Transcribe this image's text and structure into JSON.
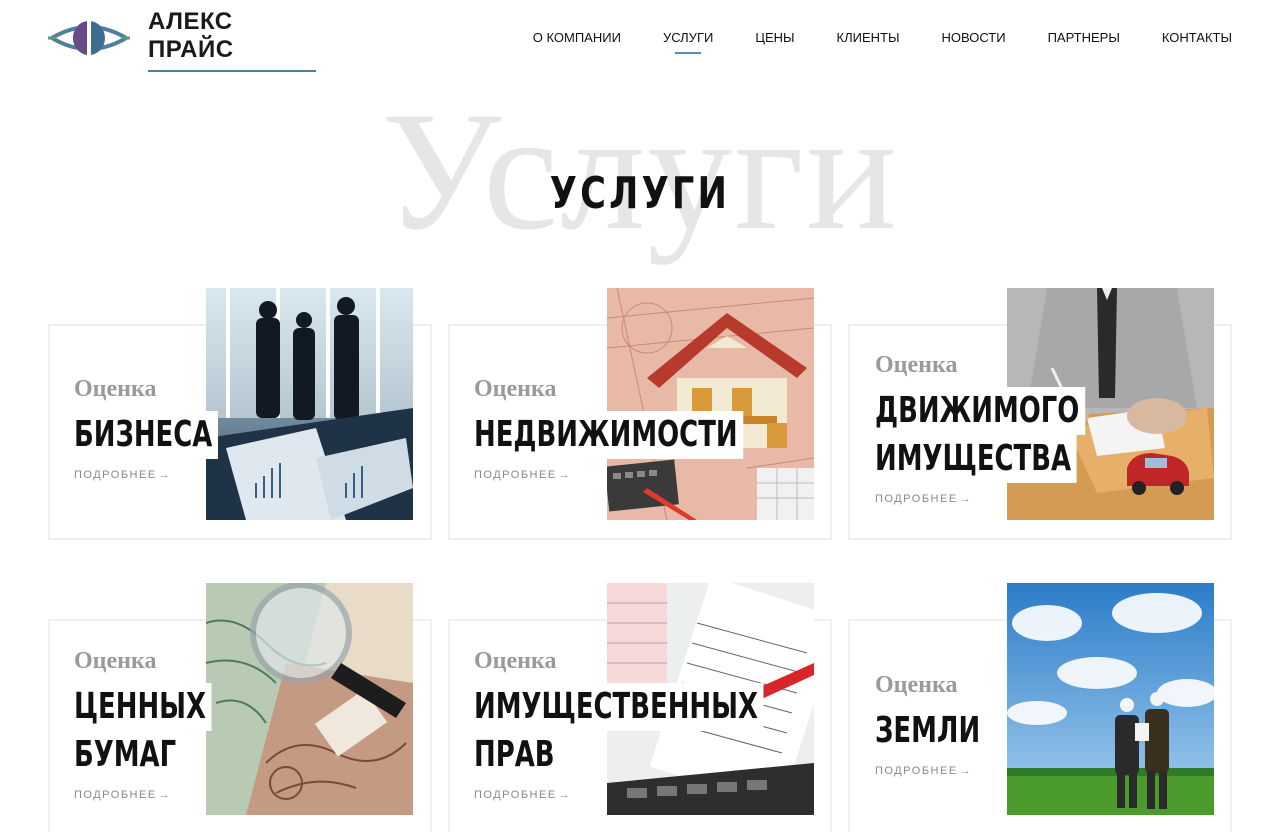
{
  "brand": {
    "name": "АЛЕКС ПРАЙС",
    "accent": "#4a7fa0"
  },
  "nav": [
    {
      "label": "О КОМПАНИИ",
      "active": false
    },
    {
      "label": "УСЛУГИ",
      "active": true
    },
    {
      "label": "ЦЕНЫ",
      "active": false
    },
    {
      "label": "КЛИЕНТЫ",
      "active": false
    },
    {
      "label": "НОВОСТИ",
      "active": false
    },
    {
      "label": "ПАРТНЕРЫ",
      "active": false
    },
    {
      "label": "КОНТАКТЫ",
      "active": false
    }
  ],
  "section": {
    "bg_word": "Услуги",
    "title": "УСЛУГИ"
  },
  "cards": [
    {
      "pre": "Оценка",
      "title_lines": [
        "БИЗНЕСА"
      ],
      "more": "ПОДРОБНЕЕ",
      "arrow": "→",
      "image": "business-people-icon"
    },
    {
      "pre": "Оценка",
      "title_lines": [
        "НЕДВИЖИМОСТИ"
      ],
      "more": "ПОДРОБНЕЕ",
      "arrow": "→",
      "image": "house-model-icon"
    },
    {
      "pre": "Оценка",
      "title_lines": [
        "ДВИЖИМОГО",
        "ИМУЩЕСТВА"
      ],
      "more": "ПОДРОБНЕЕ",
      "arrow": "→",
      "image": "signing-car-icon"
    },
    {
      "pre": "Оценка",
      "title_lines": [
        "ЦЕННЫХ",
        "БУМАГ"
      ],
      "more": "ПОДРОБНЕЕ",
      "arrow": "→",
      "image": "magnifier-bonds-icon"
    },
    {
      "pre": "Оценка",
      "title_lines": [
        "ИМУЩЕСТВЕННЫХ",
        "ПРАВ"
      ],
      "more": "ПОДРОБНЕЕ",
      "arrow": "→",
      "image": "documents-pen-icon"
    },
    {
      "pre": "Оценка",
      "title_lines": [
        "ЗЕМЛИ"
      ],
      "more": "ПОДРОБНЕЕ",
      "arrow": "→",
      "image": "land-field-icon"
    }
  ]
}
